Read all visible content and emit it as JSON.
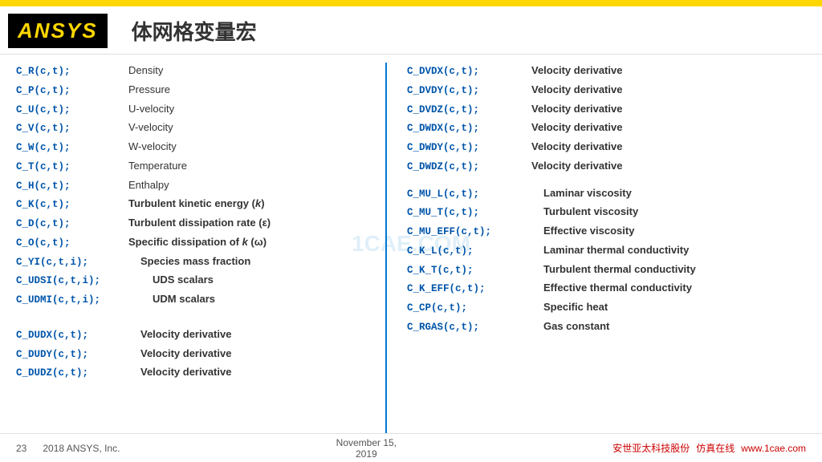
{
  "topBar": {},
  "header": {
    "logoText": "ANSYS",
    "title": "体网格变量宏"
  },
  "leftColumn": {
    "variables": [
      {
        "code": "C_R(c,t);",
        "desc": "Density"
      },
      {
        "code": "C_P(c,t);",
        "desc": "Pressure"
      },
      {
        "code": "C_U(c,t);",
        "desc": "U-velocity"
      },
      {
        "code": "C_V(c,t);",
        "desc": "V-velocity"
      },
      {
        "code": "C_W(c,t);",
        "desc": "W-velocity"
      },
      {
        "code": "C_T(c,t);",
        "desc": "Temperature"
      },
      {
        "code": "C_H(c,t);",
        "desc": "Enthalpy"
      },
      {
        "code": "C_K(c,t);",
        "desc": "Turbulent kinetic energy (k)"
      },
      {
        "code": "C_D(c,t);",
        "desc": "Turbulent dissipation rate (ε)"
      },
      {
        "code": "C_O(c,t);",
        "desc": "Specific dissipation of k (ω)"
      },
      {
        "code": "C_YI(c,t,i);",
        "desc": "Species mass fraction",
        "wide": true
      },
      {
        "code": "C_UDSI(c,t,i);",
        "desc": "UDS scalars",
        "xwide": true
      },
      {
        "code": "C_UDMI(c,t,i);",
        "desc": "UDM scalars",
        "xwide": true
      }
    ],
    "velocityVars": [
      {
        "code": "C_DUDX(c,t);",
        "desc": "Velocity derivative"
      },
      {
        "code": "C_DUDY(c,t);",
        "desc": "Velocity derivative"
      },
      {
        "code": "C_DUDZ(c,t);",
        "desc": "Velocity derivative"
      }
    ]
  },
  "rightColumn": {
    "velocityVars": [
      {
        "code": "C_DVDX(c,t);",
        "desc": "Velocity derivative"
      },
      {
        "code": "C_DVDY(c,t);",
        "desc": "Velocity derivative"
      },
      {
        "code": "C_DVDZ(c,t);",
        "desc": "Velocity derivative"
      },
      {
        "code": "C_DWDX(c,t);",
        "desc": "Velocity derivative"
      },
      {
        "code": "C_DWDY(c,t);",
        "desc": "Velocity derivative"
      },
      {
        "code": "C_DWDZ(c,t);",
        "desc": "Velocity derivative"
      }
    ],
    "otherVars": [
      {
        "code": "C_MU_L(c,t);",
        "desc": "Laminar viscosity"
      },
      {
        "code": "C_MU_T(c,t);",
        "desc": "Turbulent viscosity"
      },
      {
        "code": "C_MU_EFF(c,t);",
        "desc": "Effective viscosity"
      },
      {
        "code": "C_K_L(c,t);",
        "desc": "Laminar thermal conductivity"
      },
      {
        "code": "C_K_T(c,t);",
        "desc": "Turbulent thermal conductivity"
      },
      {
        "code": "C_K_EFF(c,t);",
        "desc": "Effective thermal conductivity"
      },
      {
        "code": "C_CP(c,t);",
        "desc": "Specific heat"
      },
      {
        "code": "C_RGAS(c,t);",
        "desc": "Gas constant"
      }
    ]
  },
  "watermark": "1CAE.COM",
  "footer": {
    "pageNumber": "23",
    "company": "2018  ANSYS, Inc.",
    "date": "November 15,",
    "year": "2019",
    "chineseText": "安世亚太科技股份",
    "url": "www.1cae.com",
    "siteLabel": "仿真在线"
  }
}
